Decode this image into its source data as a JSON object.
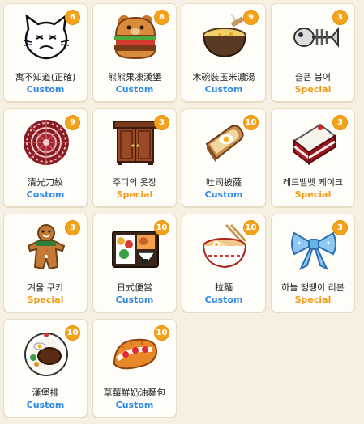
{
  "colors": {
    "background": "#f6f0e3",
    "card": "#fffdf7",
    "badge": "#f4a21a",
    "custom": "#2e88e6",
    "special": "#f29a17"
  },
  "items": [
    {
      "name": "寓不知道(正確)",
      "type": "Custom",
      "count": "6",
      "icon": "cat-doodle-icon"
    },
    {
      "name": "熊熊果凍漢堡",
      "type": "Custom",
      "count": "8",
      "icon": "bear-burger-icon"
    },
    {
      "name": "木碗裝玉米濃湯",
      "type": "Custom",
      "count": "9",
      "icon": "corn-soup-bowl-icon"
    },
    {
      "name": "슬픈 붕어",
      "type": "Special",
      "count": "3",
      "icon": "fish-bone-icon"
    },
    {
      "name": "清光刀紋",
      "type": "Custom",
      "count": "9",
      "icon": "red-round-rug-icon"
    },
    {
      "name": "주디의 옷장",
      "type": "Special",
      "count": "3",
      "icon": "wardrobe-icon"
    },
    {
      "name": "吐司披薩",
      "type": "Custom",
      "count": "10",
      "icon": "toast-egg-icon"
    },
    {
      "name": "레드벨벳 케이크",
      "type": "Special",
      "count": "3",
      "icon": "red-velvet-cake-icon"
    },
    {
      "name": "겨울 쿠키",
      "type": "Special",
      "count": "3",
      "icon": "gingerbread-cookie-icon"
    },
    {
      "name": "日式便當",
      "type": "Custom",
      "count": "10",
      "icon": "bento-box-icon"
    },
    {
      "name": "拉麵",
      "type": "Custom",
      "count": "10",
      "icon": "ramen-bowl-icon"
    },
    {
      "name": "하늘 땡땡이 리본",
      "type": "Special",
      "count": "3",
      "icon": "blue-ribbon-icon"
    },
    {
      "name": "漢堡排",
      "type": "Custom",
      "count": "10",
      "icon": "hamburg-steak-plate-icon"
    },
    {
      "name": "草莓鮮奶油麵包",
      "type": "Custom",
      "count": "10",
      "icon": "strawberry-cream-bread-icon"
    }
  ]
}
